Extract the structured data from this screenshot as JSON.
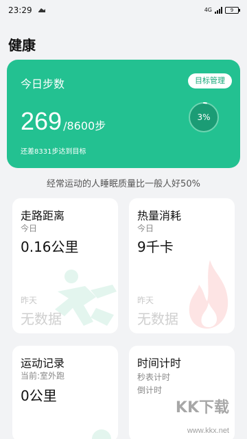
{
  "status_bar": {
    "time": "23:29",
    "network": "4G",
    "battery": "9"
  },
  "page": {
    "title": "健康"
  },
  "steps_card": {
    "title": "今日步数",
    "goal_button": "目标管理",
    "current": "269",
    "target": "/8600步",
    "progress_label": "3%",
    "progress_value": 0.03,
    "hint": "还差8331步达到目标",
    "bg_color": "#23c191"
  },
  "tip": "经常运动的人睡眠质量比一般人好50%",
  "tiles": {
    "walking": {
      "title": "走路距离",
      "today_label": "今日",
      "today_value": "0.16公里",
      "yesterday_label": "昨天",
      "yesterday_value": "无数据",
      "icon": "running-icon"
    },
    "calories": {
      "title": "热量消耗",
      "today_label": "今日",
      "today_value": "9千卡",
      "yesterday_label": "昨天",
      "yesterday_value": "无数据",
      "icon": "flame-icon"
    },
    "exercise": {
      "title": "运动记录",
      "current_label": "当前:室外跑",
      "value": "0公里"
    },
    "timer": {
      "title": "时间计时",
      "stopwatch": "秒表计时",
      "countdown": "倒计时"
    }
  },
  "watermark": {
    "text": "KK下载",
    "url": "www.kkx.net"
  }
}
